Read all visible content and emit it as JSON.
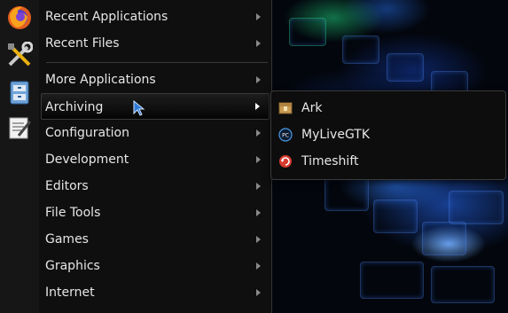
{
  "main_menu": {
    "items": [
      {
        "label": "Recent Applications",
        "has_submenu": true
      },
      {
        "label": "Recent Files",
        "has_submenu": true
      },
      {
        "label": "More Applications",
        "has_submenu": true
      },
      {
        "label": "Archiving",
        "has_submenu": true,
        "active": true
      },
      {
        "label": "Configuration",
        "has_submenu": true
      },
      {
        "label": "Development",
        "has_submenu": true
      },
      {
        "label": "Editors",
        "has_submenu": true
      },
      {
        "label": "File Tools",
        "has_submenu": true
      },
      {
        "label": "Games",
        "has_submenu": true
      },
      {
        "label": "Graphics",
        "has_submenu": true
      },
      {
        "label": "Internet",
        "has_submenu": true
      }
    ]
  },
  "submenu": {
    "items": [
      {
        "label": "Ark",
        "icon": "ark-archiver-icon"
      },
      {
        "label": "MyLiveGTK",
        "icon": "mylivegtk-icon"
      },
      {
        "label": "Timeshift",
        "icon": "timeshift-icon"
      }
    ]
  },
  "launcher": {
    "items": [
      {
        "icon": "firefox-icon"
      },
      {
        "icon": "settings-tools-icon"
      },
      {
        "icon": "file-manager-icon"
      },
      {
        "icon": "text-editor-icon"
      }
    ]
  },
  "colors": {
    "menu_bg": "#0f0f0f",
    "text": "#e6e6e6",
    "accent": "#2f7ad6"
  }
}
